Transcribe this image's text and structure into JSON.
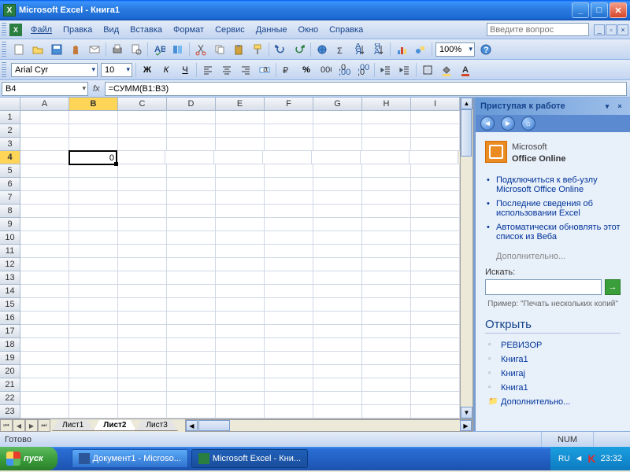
{
  "titlebar": {
    "title": "Microsoft Excel - Книга1"
  },
  "menubar": {
    "items": [
      "Файл",
      "Правка",
      "Вид",
      "Вставка",
      "Формат",
      "Сервис",
      "Данные",
      "Окно",
      "Справка"
    ],
    "question_placeholder": "Введите вопрос"
  },
  "formatbar": {
    "font_name": "Arial Cyr",
    "font_size": "10",
    "zoom": "100%"
  },
  "formula_bar": {
    "name_box": "B4",
    "fx": "fx",
    "formula": "=СУММ(B1:B3)"
  },
  "grid": {
    "columns": [
      "A",
      "B",
      "C",
      "D",
      "E",
      "F",
      "G",
      "H",
      "I"
    ],
    "active_col": "B",
    "active_row": 4,
    "rows": 23,
    "cells": {
      "B4": "0"
    }
  },
  "sheet_tabs": {
    "tabs": [
      "Лист1",
      "Лист2",
      "Лист3"
    ],
    "active": 1
  },
  "task_pane": {
    "title": "Приступая к работе",
    "office_online": "Office Online",
    "office_prefix": "Microsoft",
    "links": [
      "Подключиться к веб-узлу Microsoft Office Online",
      "Последние сведения об использовании Excel",
      "Автоматически обновлять этот список из Веба"
    ],
    "more": "Дополнительно...",
    "search_label": "Искать:",
    "example": "Пример: \"Печать нескольких копий\"",
    "open_title": "Открыть",
    "open_items": [
      "РЕВИЗОР",
      "Книга1",
      "Книгај",
      "Книга1"
    ],
    "open_more": "Дополнительно..."
  },
  "status_bar": {
    "ready": "Готово",
    "num": "NUM"
  },
  "taskbar": {
    "start": "пуск",
    "tasks": [
      {
        "label": "Документ1 - Microso...",
        "app": "word"
      },
      {
        "label": "Microsoft Excel - Кни...",
        "app": "excel",
        "active": true
      }
    ],
    "lang": "RU",
    "clock": "23:32"
  }
}
